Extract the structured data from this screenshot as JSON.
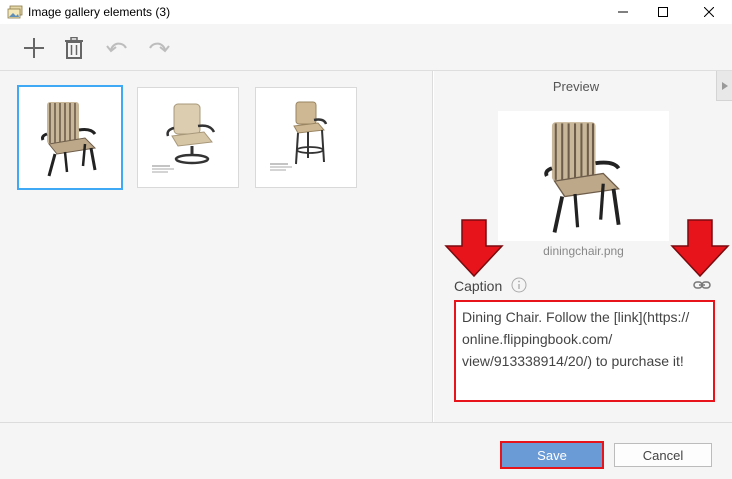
{
  "window": {
    "title": "Image gallery elements (3)",
    "controls": [
      "minimize",
      "maximize",
      "close"
    ]
  },
  "toolbar": {
    "buttons": [
      {
        "icon": "plus-icon",
        "enabled": true
      },
      {
        "icon": "trash-icon",
        "enabled": true
      },
      {
        "icon": "undo-icon",
        "enabled": false
      },
      {
        "icon": "redo-icon",
        "enabled": false
      }
    ]
  },
  "gallery": {
    "thumbnails": [
      {
        "subject": "striped dining chair",
        "selected": true
      },
      {
        "subject": "beige swivel chair",
        "selected": false
      },
      {
        "subject": "beige bar stool",
        "selected": false
      }
    ]
  },
  "preview": {
    "title": "Preview",
    "filename": "diningchair.png"
  },
  "caption": {
    "label": "Caption",
    "text": "Dining Chair. Follow the [link](https://\nonline.flippingbook.com/\nview/913338914/20/) to purchase it!"
  },
  "footer": {
    "save_label": "Save",
    "cancel_label": "Cancel"
  },
  "colors": {
    "accent_selected": "#3fa9f5",
    "save_button": "#6b9bd6",
    "annotation_red": "#e8141c",
    "panel_bg": "#f5f5f5"
  }
}
